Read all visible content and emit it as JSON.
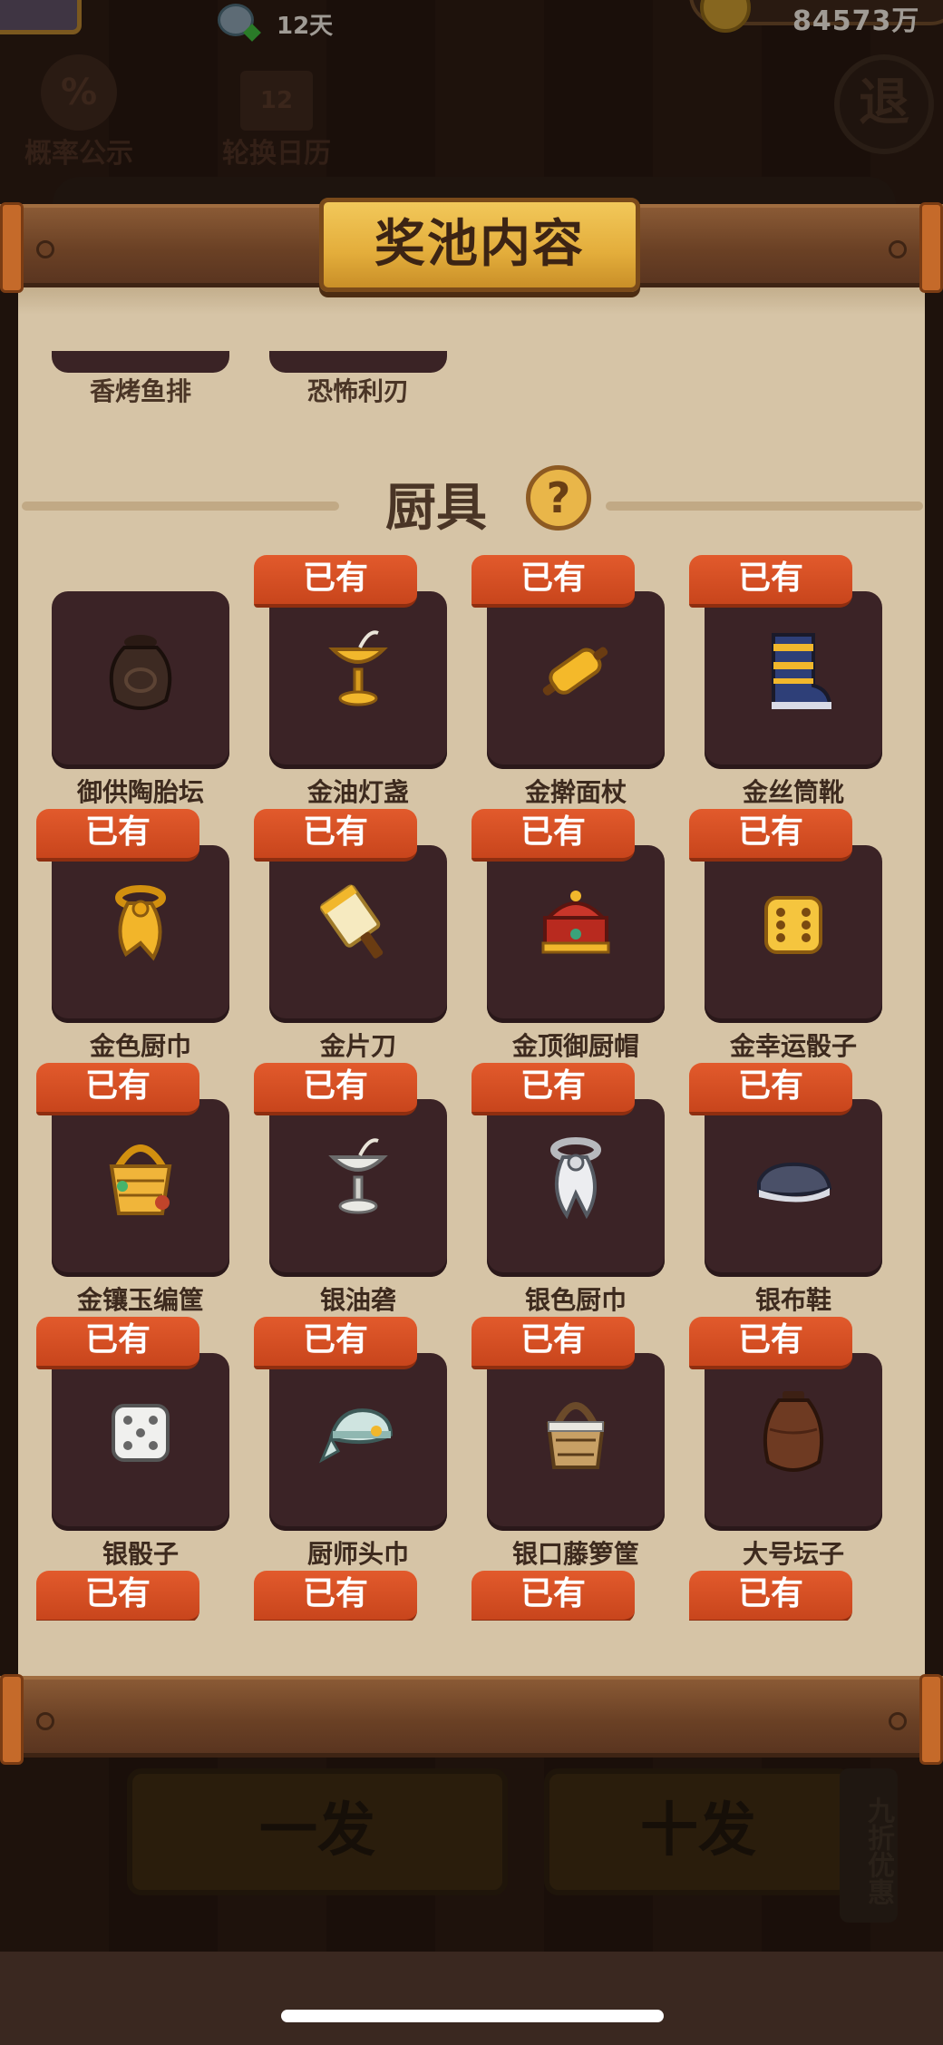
{
  "background": {
    "timer": "12天",
    "gold": "84573万",
    "probability_label": "概率公示",
    "probability_symbol": "%",
    "calendar_label": "轮换日历",
    "calendar_number": "12",
    "exit_label": "退",
    "draw_one_label": "一发",
    "draw_ten_label": "十发",
    "discount_label": "九折优惠"
  },
  "modal": {
    "title": "奖池内容",
    "prev_row": [
      "香烤鱼排",
      "恐怖利刃"
    ],
    "section": {
      "title": "厨具",
      "help": "?"
    },
    "owned_label": "已有",
    "items": [
      {
        "name": "御供陶胎坛",
        "owned": false,
        "icon": "clay-jar-icon"
      },
      {
        "name": "金油灯盏",
        "owned": true,
        "icon": "gold-oil-lamp-icon"
      },
      {
        "name": "金擀面杖",
        "owned": true,
        "icon": "gold-rolling-pin-icon"
      },
      {
        "name": "金丝筒靴",
        "owned": true,
        "icon": "gold-boot-icon"
      },
      {
        "name": "金色厨巾",
        "owned": true,
        "icon": "gold-scarf-icon"
      },
      {
        "name": "金片刀",
        "owned": true,
        "icon": "gold-cleaver-icon"
      },
      {
        "name": "金顶御厨帽",
        "owned": true,
        "icon": "chef-hat-icon"
      },
      {
        "name": "金幸运骰子",
        "owned": true,
        "icon": "gold-dice-icon"
      },
      {
        "name": "金镶玉编筐",
        "owned": true,
        "icon": "gold-basket-icon"
      },
      {
        "name": "银油砻",
        "owned": true,
        "icon": "silver-oil-lamp-icon"
      },
      {
        "name": "银色厨巾",
        "owned": true,
        "icon": "silver-scarf-icon"
      },
      {
        "name": "银布鞋",
        "owned": true,
        "icon": "silver-shoe-icon"
      },
      {
        "name": "银骰子",
        "owned": true,
        "icon": "silver-dice-icon"
      },
      {
        "name": "厨师头巾",
        "owned": true,
        "icon": "chef-headscarf-icon"
      },
      {
        "name": "银口藤箩筐",
        "owned": true,
        "icon": "rattan-basket-icon"
      },
      {
        "name": "大号坛子",
        "owned": true,
        "icon": "large-jar-icon"
      }
    ],
    "next_row_tags": [
      "已有",
      "已有",
      "已有",
      "已有"
    ]
  }
}
